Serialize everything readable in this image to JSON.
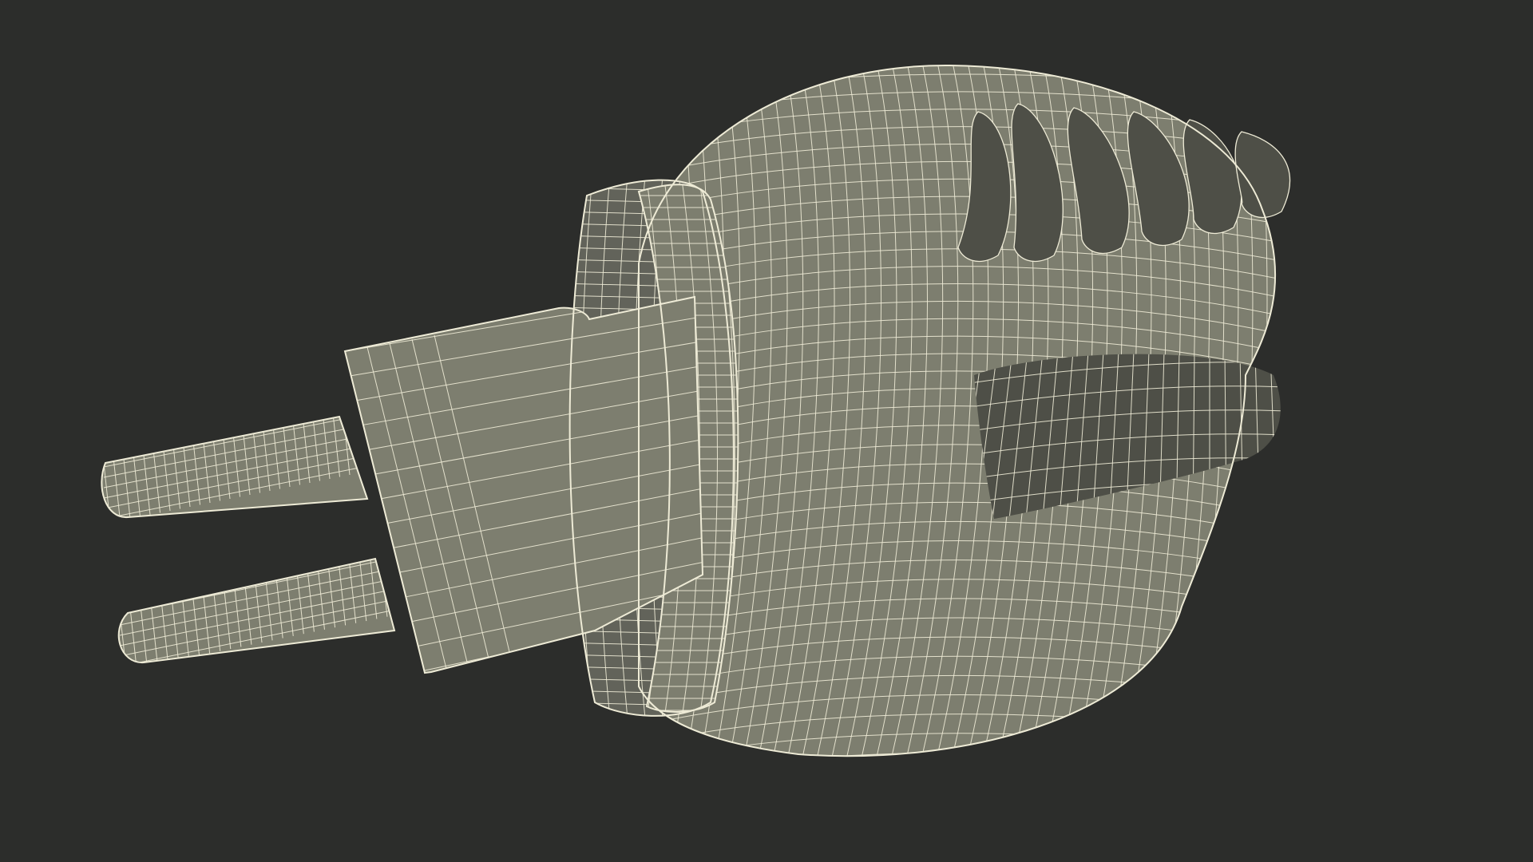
{
  "scene": {
    "subject": "plug-in-diffuser-wireframe",
    "colors": {
      "background": "#2c2d2b",
      "surface": "#7d7e6f",
      "surface_dark": "#62635a",
      "surface_shadow": "#4e4f47",
      "wire": "#eeebd6"
    }
  }
}
